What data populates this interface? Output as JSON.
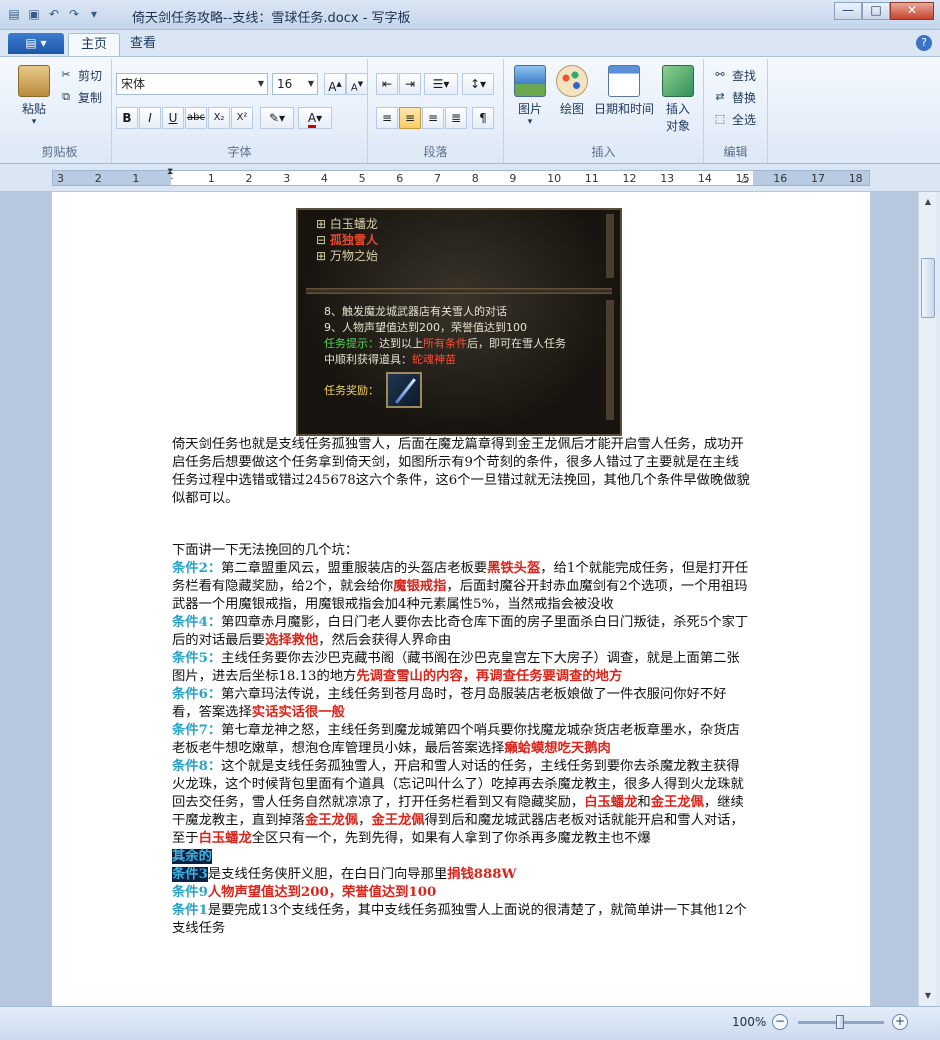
{
  "window": {
    "title": "倚天剑任务攻略--支线：雪球任务.docx - 写字板",
    "controls": {
      "minimize": "—",
      "maximize": "□",
      "close": "✕"
    }
  },
  "tabs": {
    "app_menu": "▤ ▾",
    "items": [
      "主页",
      "查看"
    ],
    "help": "?"
  },
  "ribbon": {
    "clipboard": {
      "label": "剪贴板",
      "paste": "粘贴",
      "cut": "剪切",
      "copy": "复制"
    },
    "font": {
      "label": "字体",
      "family": "宋体",
      "size": "16",
      "buttons": [
        "B",
        "I",
        "U",
        "abc",
        "X₂",
        "X²"
      ]
    },
    "paragraph": {
      "label": "段落"
    },
    "insert": {
      "label": "插入",
      "picture": "图片",
      "paint": "绘图",
      "datetime": "日期和时间",
      "object_line1": "插入",
      "object_line2": "对象"
    },
    "edit": {
      "label": "编辑",
      "find": "查找",
      "replace": "替换",
      "select_all": "全选"
    }
  },
  "ruler": {
    "ticks": [
      "3",
      "2",
      "1",
      "",
      "1",
      "2",
      "3",
      "4",
      "5",
      "6",
      "7",
      "8",
      "9",
      "10",
      "11",
      "12",
      "13",
      "14",
      "15",
      "16",
      "17",
      "18"
    ]
  },
  "game_image": {
    "tree": [
      "白玉蟠龙",
      "孤独雪人",
      "万物之始"
    ],
    "lines": [
      "8、触发魔龙城武器店有关雪人的对话",
      "9、人物声望值达到200，荣誉值达到100"
    ],
    "hint_label": "任务提示：",
    "hint_text_a": "达到以上",
    "hint_red": "所有条件",
    "hint_text_b": "后，即可在雪人任务",
    "hint_line2": "中顺利获得道具：",
    "hint_item": "蛇魂神苗",
    "reward": "任务奖励："
  },
  "doc": {
    "intro": "倚天剑任务也就是支线任务孤独雪人，后面在魔龙篇章得到金王龙佩后才能开启雪人任务，成功开启任务后想要做这个任务拿到倚天剑，如图所示有9个苛刻的条件，很多人错过了主要就是在主线任务过程中选错或错过245678这六个条件，这6个一旦错过就无法挽回，其他几个条件早做晚做貌似都可以。",
    "lead": "下面讲一下无法挽回的几个坑：",
    "c2_label": "条件2：",
    "c2_a": "第二章盟重风云，盟重服装店的头盔店老板要",
    "c2_r1": "黑铁头盔",
    "c2_b": "，给1个就能完成任务，但是打开任务栏看有隐藏奖励，给2个，就会给你",
    "c2_r2": "魔银戒指",
    "c2_c": "，后面封魔谷开封赤血魔剑有2个选项，一个用祖玛武器一个用魔银戒指，用魔银戒指会加4种元素属性5%，当然戒指会被没收",
    "c4_label": "条件4：",
    "c4_a": "第四章赤月魔影，白日门老人要你去比奇仓库下面的房子里面杀白日门叛徒，杀死5个家丁后的对话最后要",
    "c4_r": "选择救他",
    "c4_b": "，然后会获得人界命由",
    "c5_label": "条件5：",
    "c5_a": "主线任务要你去沙巴克藏书阁（藏书阁在沙巴克皇宫左下大房子）调查，就是上面第二张图片，进去后坐标18.13的地方",
    "c5_r": "先调查雪山的内容，再调查任务要调查的地方",
    "c6_label": "条件6：",
    "c6_a": "第六章玛法传说，主线任务到苍月岛时，苍月岛服装店老板娘做了一件衣服问你好不好看，答案选择",
    "c6_r": "实话实话很一般",
    "c7_label": "条件7：",
    "c7_a": "第七章龙神之怒，主线任务到魔龙城第四个哨兵要你找魔龙城杂货店老板章墨水，杂货店老板老牛想吃嫩草，想泡仓库管理员小妹，最后答案选择",
    "c7_r": "癞蛤蟆想吃天鹅肉",
    "c8_label": "条件8：",
    "c8_a": "这个就是支线任务孤独雪人，开启和雪人对话的任务，主线任务到要你去杀魔龙教主获得火龙珠，这个时候背包里面有个道具（忘记叫什么了）吃掉再去杀魔龙教主，很多人得到火龙珠就回去交任务，雪人任务自然就凉凉了，打开任务栏看到又有隐藏奖励，",
    "c8_r1": "白玉蟠龙",
    "c8_and": "和",
    "c8_r2": "金王龙佩",
    "c8_b": "，继续干魔龙教主，直到掉落",
    "c8_r3": "金王龙佩",
    "c8_c": "，",
    "c8_r4": "金王龙佩",
    "c8_d": "得到后和魔龙城武器店老板对话就能开启和雪人对话，至于",
    "c8_r5": "白玉蟠龙",
    "c8_e": "全区只有一个，先到先得，如果有人拿到了你杀再多魔龙教主也不爆",
    "rest_label": "其余的",
    "c3_label": "条件3",
    "c3_a": "是支线任务侠肝义胆，在白日门向导那里",
    "c3_r": "捐钱888W",
    "c9_label": "条件9",
    "c9_r": "人物声望值达到200，荣誉值达到100",
    "c1_label": "条件1",
    "c1_a": "是要完成13个支线任务，其中支线任务孤独雪人上面说的很清楚了，就简单讲一下其他12个支线任务"
  },
  "status": {
    "zoom": "100%",
    "zoom_out": "−",
    "zoom_in": "+"
  }
}
